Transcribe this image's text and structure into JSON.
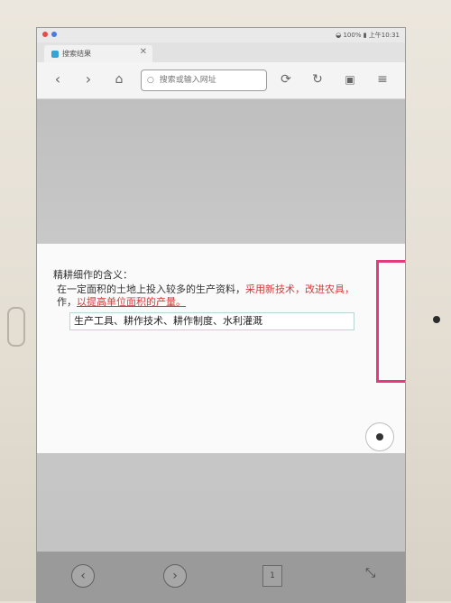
{
  "statusbar": {
    "battery": "100%",
    "time": "上午10:31"
  },
  "browser": {
    "tab_title": "搜索结果",
    "tab_close_glyph": "✕",
    "search_placeholder": "搜索或输入网址",
    "icons": {
      "back": "back-icon",
      "forward": "forward-icon",
      "home": "home-icon",
      "refresh": "refresh-icon",
      "reload": "reload-icon",
      "bag": "bag-icon",
      "menu": "menu-icon"
    }
  },
  "content": {
    "title": "精耕细作的含义：",
    "line1_prefix": "在一定面积的土地上投入较多的生产资料，",
    "line1_red": "采用新技术，改进农具，",
    "line1_suffix": "",
    "line2_prefix": "作，",
    "line2_red": "以提高单位面积的产量。",
    "answer": "生产工具、耕作技术、耕作制度、水利灌溉"
  },
  "bottombar": {
    "back_glyph": "‹",
    "forward_glyph": "›",
    "tabs_count": "1"
  },
  "colors": {
    "highlight_box": "#e4397a",
    "red_text": "#d43b3b"
  }
}
